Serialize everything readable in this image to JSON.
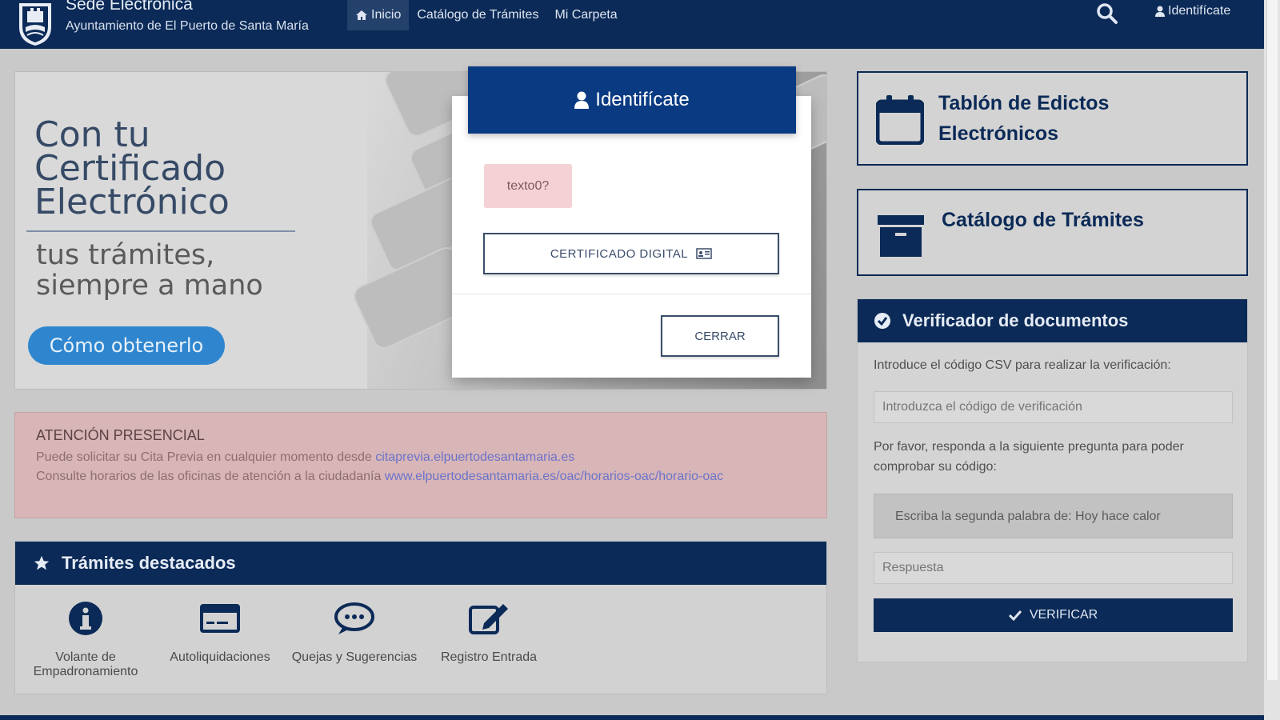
{
  "header": {
    "title": "Sede Electrónica",
    "subtitle": "Ayuntamiento de El Puerto de Santa María",
    "nav": [
      {
        "label": "Inicio",
        "icon": "home-icon",
        "active": true
      },
      {
        "label": "Catálogo de Trámites",
        "active": false
      },
      {
        "label": "Mi Carpeta",
        "active": false
      }
    ],
    "login_label": "Identifícate"
  },
  "hero": {
    "title": "Con tu\nCertificado\nElectrónico",
    "subtitle": "tus trámites,\nsiempre a mano",
    "button": "Cómo obtenerlo"
  },
  "notice": {
    "title": "ATENCIÓN PRESENCIAL",
    "line1_text": "Puede solicitar su Cita Previa en cualquier momento desde ",
    "line1_link": "citaprevia.elpuertodesantamaria.es",
    "line2_text": "Consulte horarios de las oficinas de atención a la ciudadanía ",
    "line2_link": "www.elpuertodesantamaria.es/oac/horarios-oac/horario-oac"
  },
  "featured": {
    "title": "Trámites destacados",
    "items": [
      {
        "label": "Volante de Empadronamiento",
        "icon": "info-icon"
      },
      {
        "label": "Autoliquidaciones",
        "icon": "credit-card-icon"
      },
      {
        "label": "Quejas y Sugerencias",
        "icon": "chat-bubble-icon"
      },
      {
        "label": "Registro Entrada",
        "icon": "edit-icon"
      }
    ]
  },
  "modal": {
    "title": "Identifícate",
    "alert_text": "texto0?",
    "cert_button": "CERTIFICADO DIGITAL",
    "close_button": "CERRAR"
  },
  "right": {
    "card1_title": "Tablón de Edictos\nElectrónicos",
    "card2_title": "Catálogo de Trámites",
    "verifier_title": "Verificador de documentos",
    "csv_instruction": "Introduce el código CSV para realizar la verificación:",
    "csv_placeholder": "Introduzca el código de verificación",
    "question_instruction": "Por favor, responda a la siguiente pregunta para poder comprobar su código:",
    "question_text": "Escriba la segunda palabra de: Hoy hace calor",
    "answer_placeholder": "Respuesta",
    "verify_button": "VERIFICAR"
  },
  "colors": {
    "navy": "#0b2a57",
    "modal_header": "#0a3b82",
    "hero_button": "#2f86cf",
    "notice_bg": "#d8b5b7",
    "alert_bg": "#f3d1d5"
  }
}
